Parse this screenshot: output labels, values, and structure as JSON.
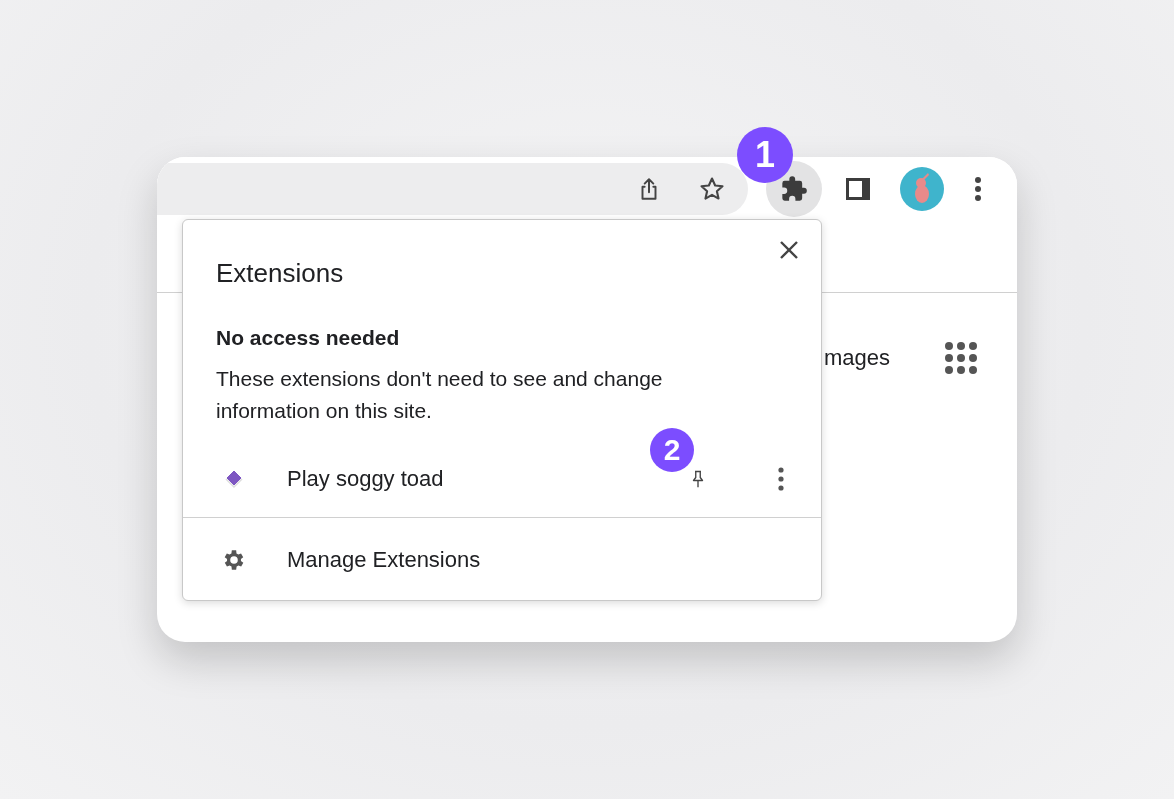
{
  "toolbar": {
    "extensions_active": true
  },
  "page": {
    "partial_link": "mages"
  },
  "popup": {
    "title": "Extensions",
    "section_heading": "No access needed",
    "section_text": "These extensions don't need to see and change information on this site.",
    "extensions": [
      {
        "name": "Play soggy toad"
      }
    ],
    "footer_link": "Manage Extensions"
  },
  "callouts": [
    {
      "label": "1",
      "kind": "toolbar"
    },
    {
      "label": "2",
      "kind": "row"
    }
  ]
}
